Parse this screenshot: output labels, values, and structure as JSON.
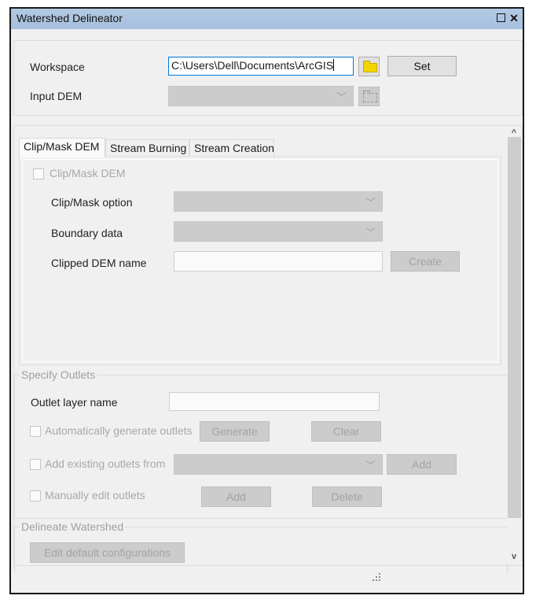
{
  "window": {
    "title": "Watershed Delineator",
    "maximize_icon": "maximize-icon",
    "close_label": "✕"
  },
  "top": {
    "workspace_label": "Workspace",
    "workspace_value": "C:\\Users\\Dell\\Documents\\ArcGIS",
    "workspace_browse_icon": "folder-icon",
    "set_label": "Set",
    "input_dem_label": "Input DEM",
    "input_dem_value": "",
    "input_dem_browse_icon": "folder-icon"
  },
  "tabs": [
    {
      "label": "Clip/Mask DEM",
      "active": true
    },
    {
      "label": "Stream Burning",
      "active": false
    },
    {
      "label": "Stream Creation",
      "active": false
    }
  ],
  "clip_tab": {
    "enable_label": "Clip/Mask DEM",
    "enable_checked": false,
    "option_label": "Clip/Mask option",
    "option_value": "",
    "boundary_label": "Boundary data",
    "boundary_value": "",
    "clipped_name_label": "Clipped DEM name",
    "clipped_name_value": "",
    "create_label": "Create"
  },
  "outlets": {
    "group_title": "Specify Outlets",
    "layer_name_label": "Outlet layer name",
    "layer_name_value": "",
    "auto_label": "Automatically generate outlets",
    "auto_checked": false,
    "generate_label": "Generate",
    "clear_label": "Clear",
    "existing_label": "Add existing outlets from",
    "existing_checked": false,
    "existing_value": "",
    "existing_add_label": "Add",
    "manual_label": "Manually edit outlets",
    "manual_checked": false,
    "manual_add_label": "Add",
    "delete_label": "Delete"
  },
  "delineate": {
    "group_title": "Delineate Watershed",
    "edit_config_label": "Edit default configurations"
  },
  "scrollbar": {
    "up_glyph": "^",
    "down_glyph": "v"
  },
  "colors": {
    "titlebar": "#a7c0de",
    "folder": "#f3d400",
    "focus_border": "#0078d7"
  }
}
